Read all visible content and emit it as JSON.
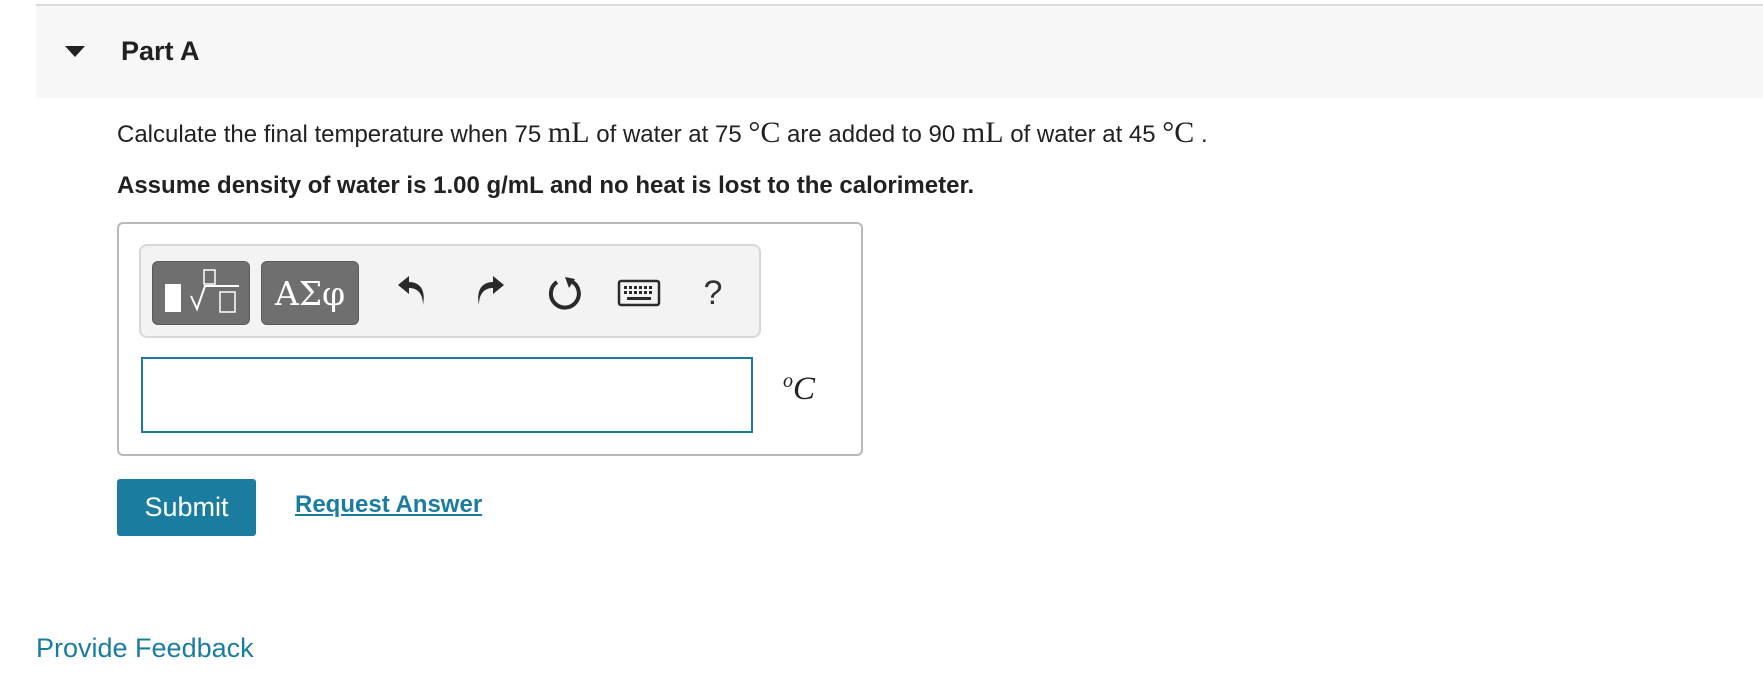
{
  "part": {
    "title": "Part A"
  },
  "question": {
    "segments": {
      "t1": "Calculate the final temperature when 75 ",
      "m1": "mL",
      "t2": " of water at 75 ",
      "m2": "°C",
      "t3": " are added to 90 ",
      "m3": "mL",
      "t4": " of water at 45 ",
      "m4": "°C",
      "t5": " ."
    },
    "assumption": "Assume density of water is 1.00 g/mL and no heat is lost to the calorimeter."
  },
  "toolbar": {
    "symbols_label": "ΑΣφ",
    "help_label": "?"
  },
  "answer": {
    "value": "",
    "unit_degree": "o",
    "unit_letter": "C"
  },
  "actions": {
    "submit_label": "Submit",
    "request_answer_label": "Request Answer",
    "feedback_label": "Provide Feedback"
  },
  "colors": {
    "accent": "#1a7da0",
    "toolbar_button": "#6f6f6f",
    "header_bg": "#f7f7f7"
  }
}
